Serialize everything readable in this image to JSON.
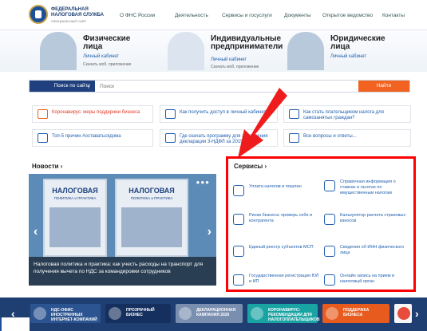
{
  "header": {
    "brand_line1": "ФЕДЕРАЛЬНАЯ",
    "brand_line2": "НАЛОГОВАЯ СЛУЖБА",
    "brand_sub": "ОФИЦИАЛЬНЫЙ САЙТ",
    "nav": [
      "О ФНС России",
      "Деятельность",
      "Сервисы и госуслуги",
      "Документы",
      "Открытое ведомство",
      "Контакты"
    ]
  },
  "personas": [
    {
      "title1": "Физические",
      "title2": "лица",
      "cabinet": "Личный кабинет",
      "app": "Скачать моб. приложение"
    },
    {
      "title1": "Индивидуальные",
      "title2": "предприниматели",
      "cabinet": "Личный кабинет",
      "app": "Скачать моб. приложение"
    },
    {
      "title1": "Юридические",
      "title2": "лица",
      "cabinet": "Личный кабинет",
      "app": ""
    }
  ],
  "search": {
    "scope": "Поиск по сайту",
    "placeholder": "Поиск",
    "button": "Найти"
  },
  "quick_links": [
    "Коронавирус: меры поддержки бизнеса",
    "Как получить доступ в личный кабинет",
    "Как стать плательщиком налога для самозанятых граждан?",
    "Топ-5 причин #оставатьсядома",
    "Где скачать программу для заполнения декларации 3-НДФЛ за 2019 г.",
    "Все вопросы и ответы..."
  ],
  "news": {
    "heading": "Новости ›",
    "magazine_title": "НАЛОГОВАЯ",
    "magazine_sub": "ПОЛИТИКА и ПРАКТИКА",
    "caption": "Налоговая политика и практика: как учесть расходы на транспорт для получения вычета по НДС за командировки сотрудников"
  },
  "services": {
    "heading": "Сервисы ›",
    "items": [
      "Уплата налогов и пошлин",
      "Справочная информация о ставках и льготах по имущественным налогам",
      "Риски бизнеса: проверь себя и контрагента",
      "Калькулятор расчета страховых взносов",
      "Единый реестр субъектов МСП",
      "Сведения об ИНН физического лица",
      "Государственная регистрация ЮЛ и ИП",
      "Онлайн запись на прием в налоговый орган"
    ]
  },
  "promos": [
    "НДС-ОФИС ИНОСТРАННЫХ ИНТЕРНЕТ-КОМПАНИЙ",
    "ПРОЗРАЧНЫЙ БИЗНЕС",
    "ДЕКЛАРАЦИОННАЯ КАМПАНИЯ 2020",
    "КОРОНАВИРУС: РЕКОМЕНДАЦИИ ДЛЯ НАЛОГОПЛАТЕЛЬЩИКОВ",
    "ПОДДЕРЖКА БИЗНЕСА"
  ],
  "colors": {
    "accent": "#f26322",
    "brand": "#1f3f7e",
    "highlight": "#ff0000"
  }
}
